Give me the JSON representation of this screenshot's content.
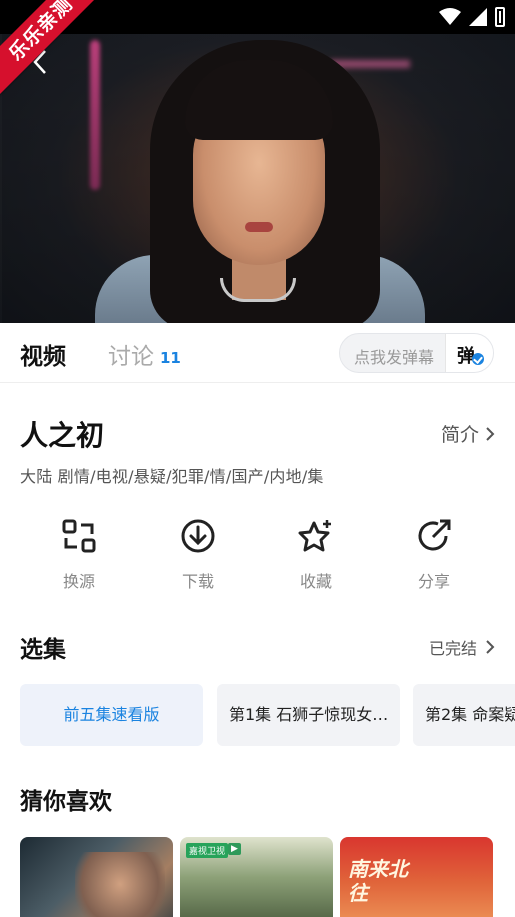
{
  "watermark": {
    "text": "乐乐亲测"
  },
  "tabs": {
    "video": "视频",
    "discuss": "讨论",
    "discuss_count": "11"
  },
  "danmaku": {
    "placeholder": "点我发弹幕",
    "button_char": "弹"
  },
  "show": {
    "title": "人之初",
    "intro_link": "简介",
    "tags": "大陆  剧情/电视/悬疑/犯罪/情/国产/内地/集"
  },
  "actions": {
    "switch_source": "换源",
    "download": "下载",
    "favorite": "收藏",
    "share": "分享"
  },
  "episodes": {
    "heading": "选集",
    "status": "已完结",
    "items": [
      {
        "label": "前五集速看版"
      },
      {
        "label": "第1集 石狮子惊现女…"
      },
      {
        "label": "第2集 命案疑"
      }
    ]
  },
  "recommend": {
    "heading": "猜你喜欢",
    "posters": [
      {
        "badge": "",
        "text": ""
      },
      {
        "badge": "嘉视卫视",
        "text": ""
      },
      {
        "badge": "",
        "text": "南来北往"
      }
    ]
  },
  "colors": {
    "accent": "#1a83e0",
    "watermark_bg": "#d6102d"
  }
}
